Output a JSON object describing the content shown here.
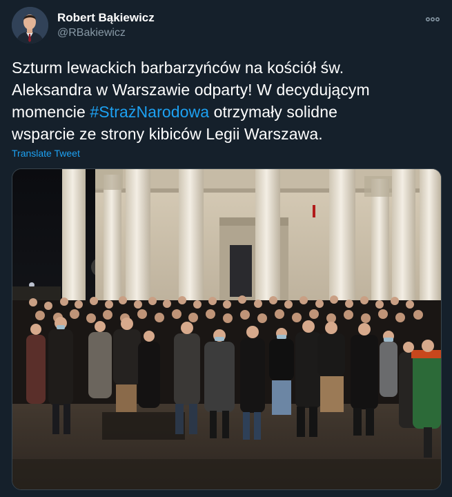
{
  "author": {
    "display_name": "Robert Bąkiewicz",
    "handle": "@RBakiewicz"
  },
  "tweet": {
    "line1": "Szturm lewackich barbarzyńców na kościół św.",
    "line2": "Aleksandra w Warszawie odparty! W decydującym",
    "line3_before": "momencie ",
    "hashtag": "#StrażNarodowa",
    "line3_after": " otrzymały solidne",
    "line4": "wsparcie ze strony kibiców Legii Warszawa.",
    "translate_label": "Translate Tweet"
  },
  "icons": {
    "more": "more-options-icon"
  },
  "colors": {
    "background": "#15202b",
    "link": "#1da1f2",
    "secondary_text": "#8899a6"
  }
}
